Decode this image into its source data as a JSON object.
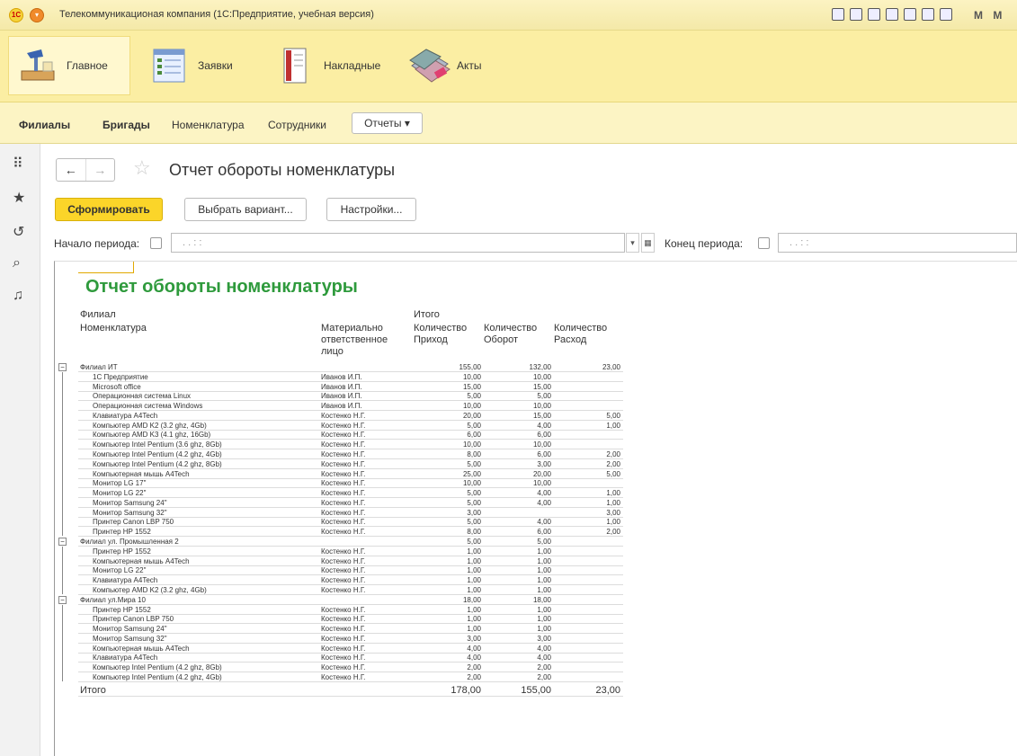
{
  "window": {
    "title": "Телекоммуникационая компания  (1С:Предприятие, учебная версия)",
    "right_letters": "M M"
  },
  "sections": [
    {
      "label": "Главное",
      "icon": "desk-lamp-icon"
    },
    {
      "label": "Заявки",
      "icon": "checklist-icon"
    },
    {
      "label": "Накладные",
      "icon": "document-icon"
    },
    {
      "label": "Акты",
      "icon": "papers-icon"
    }
  ],
  "nav": {
    "items": [
      "Филиалы",
      "Бригады",
      "Номенклатура",
      "Сотрудники"
    ],
    "reports": "Отчеты ▾"
  },
  "page": {
    "title": "Отчет обороты номенклатуры",
    "generate": "Сформировать",
    "variant": "Выбрать вариант...",
    "settings": "Настройки...",
    "start_label": "Начало периода:",
    "start_value": ".  .       :  :",
    "end_label": "Конец периода:",
    "end_value": ".  .       :  :"
  },
  "report": {
    "title": "Отчет обороты номенклатуры",
    "headers": {
      "filial": "Филиал",
      "itogo": "Итого",
      "nomenclature": "Номенклатура",
      "responsible": "Материально ответственное лицо",
      "qty_in": "Количество Приход",
      "qty_turn": "Количество Оборот",
      "qty_out": "Количество Расход"
    },
    "groups": [
      {
        "name": "Филиал ИТ",
        "in": "155,00",
        "turn": "132,00",
        "out": "23,00",
        "rows": [
          [
            "1С Предприятие",
            "Иванов И.П.",
            "10,00",
            "10,00",
            ""
          ],
          [
            "Microsoft office",
            "Иванов И.П.",
            "15,00",
            "15,00",
            ""
          ],
          [
            "Операционная система Linux",
            "Иванов И.П.",
            "5,00",
            "5,00",
            ""
          ],
          [
            "Операционная система Windows",
            "Иванов И.П.",
            "10,00",
            "10,00",
            ""
          ],
          [
            "Клавиатура A4Tech",
            "Костенко Н.Г.",
            "20,00",
            "15,00",
            "5,00"
          ],
          [
            "Компьютер AMD K2 (3.2 ghz, 4Gb)",
            "Костенко Н.Г.",
            "5,00",
            "4,00",
            "1,00"
          ],
          [
            "Компьютер AMD K3 (4.1 ghz, 16Gb)",
            "Костенко Н.Г.",
            "6,00",
            "6,00",
            ""
          ],
          [
            "Компьютер Intel Pentium (3.6 ghz, 8Gb)",
            "Костенко Н.Г.",
            "10,00",
            "10,00",
            ""
          ],
          [
            "Компьютер Intel Pentium (4.2 ghz, 4Gb)",
            "Костенко Н.Г.",
            "8,00",
            "6,00",
            "2,00"
          ],
          [
            "Компьютер Intel Pentium (4.2 ghz, 8Gb)",
            "Костенко Н.Г.",
            "5,00",
            "3,00",
            "2,00"
          ],
          [
            "Компьютерная мышь A4Tech",
            "Костенко Н.Г.",
            "25,00",
            "20,00",
            "5,00"
          ],
          [
            "Монитор LG 17\"",
            "Костенко Н.Г.",
            "10,00",
            "10,00",
            ""
          ],
          [
            "Монитор LG 22\"",
            "Костенко Н.Г.",
            "5,00",
            "4,00",
            "1,00"
          ],
          [
            "Монитор Samsung 24\"",
            "Костенко Н.Г.",
            "5,00",
            "4,00",
            "1,00"
          ],
          [
            "Монитор Samsung 32\"",
            "Костенко Н.Г.",
            "3,00",
            "",
            "3,00"
          ],
          [
            "Принтер Canon LBP 750",
            "Костенко Н.Г.",
            "5,00",
            "4,00",
            "1,00"
          ],
          [
            "Принтер HP 1552",
            "Костенко Н.Г.",
            "8,00",
            "6,00",
            "2,00"
          ]
        ]
      },
      {
        "name": "Филиал ул. Промышленная 2",
        "in": "5,00",
        "turn": "5,00",
        "out": "",
        "rows": [
          [
            "Принтер HP 1552",
            "Костенко Н.Г.",
            "1,00",
            "1,00",
            ""
          ],
          [
            "Компьютерная мышь A4Tech",
            "Костенко Н.Г.",
            "1,00",
            "1,00",
            ""
          ],
          [
            "Монитор LG 22\"",
            "Костенко Н.Г.",
            "1,00",
            "1,00",
            ""
          ],
          [
            "Клавиатура A4Tech",
            "Костенко Н.Г.",
            "1,00",
            "1,00",
            ""
          ],
          [
            "Компьютер AMD K2 (3.2 ghz, 4Gb)",
            "Костенко Н.Г.",
            "1,00",
            "1,00",
            ""
          ]
        ]
      },
      {
        "name": "Филиал ул.Мира 10",
        "in": "18,00",
        "turn": "18,00",
        "out": "",
        "rows": [
          [
            "Принтер HP 1552",
            "Костенко Н.Г.",
            "1,00",
            "1,00",
            ""
          ],
          [
            "Принтер Canon LBP 750",
            "Костенко Н.Г.",
            "1,00",
            "1,00",
            ""
          ],
          [
            "Монитор Samsung 24\"",
            "Костенко Н.Г.",
            "1,00",
            "1,00",
            ""
          ],
          [
            "Монитор Samsung 32\"",
            "Костенко Н.Г.",
            "3,00",
            "3,00",
            ""
          ],
          [
            "Компьютерная мышь A4Tech",
            "Костенко Н.Г.",
            "4,00",
            "4,00",
            ""
          ],
          [
            "Клавиатура A4Tech",
            "Костенко Н.Г.",
            "4,00",
            "4,00",
            ""
          ],
          [
            "Компьютер Intel Pentium (4.2 ghz, 8Gb)",
            "Костенко Н.Г.",
            "2,00",
            "2,00",
            ""
          ],
          [
            "Компьютер Intel Pentium (4.2 ghz, 4Gb)",
            "Костенко Н.Г.",
            "2,00",
            "2,00",
            ""
          ]
        ]
      }
    ],
    "total": {
      "label": "Итого",
      "in": "178,00",
      "turn": "155,00",
      "out": "23,00"
    }
  }
}
